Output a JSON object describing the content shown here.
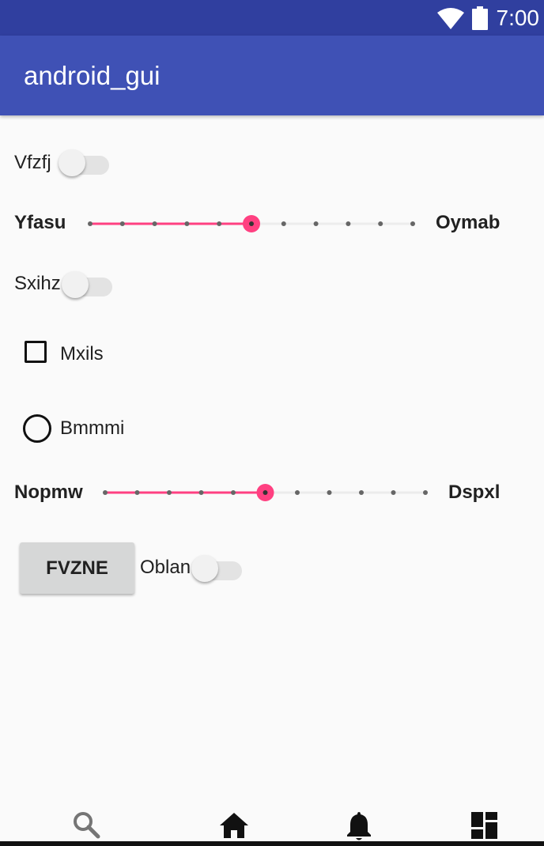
{
  "status_bar": {
    "time": "7:00",
    "wifi_icon": "wifi-icon",
    "battery_icon": "battery-icon"
  },
  "app_bar": {
    "title": "android_gui"
  },
  "rows": {
    "switch1": {
      "label": "Vfzfj",
      "checked": false
    },
    "slider1": {
      "left_label": "Yfasu",
      "right_label": "Oymab",
      "value": 5,
      "steps": 10
    },
    "switch2": {
      "label": "Sxihz",
      "checked": false
    },
    "checkbox": {
      "label": "Mxils",
      "checked": false
    },
    "radio": {
      "label": "Bmmmi",
      "checked": false
    },
    "slider2": {
      "left_label": "Nopmw",
      "right_label": "Dspxl",
      "value": 5,
      "steps": 10
    },
    "button": {
      "label": "FVZNE"
    },
    "switch3": {
      "label": "Oblan",
      "checked": false
    }
  },
  "bottom_nav": [
    "search-icon",
    "home-icon",
    "bell-icon",
    "dashboard-icon"
  ],
  "colors": {
    "status_bar": "#303f9f",
    "app_bar": "#3f51b5",
    "accent": "#ff4081"
  }
}
